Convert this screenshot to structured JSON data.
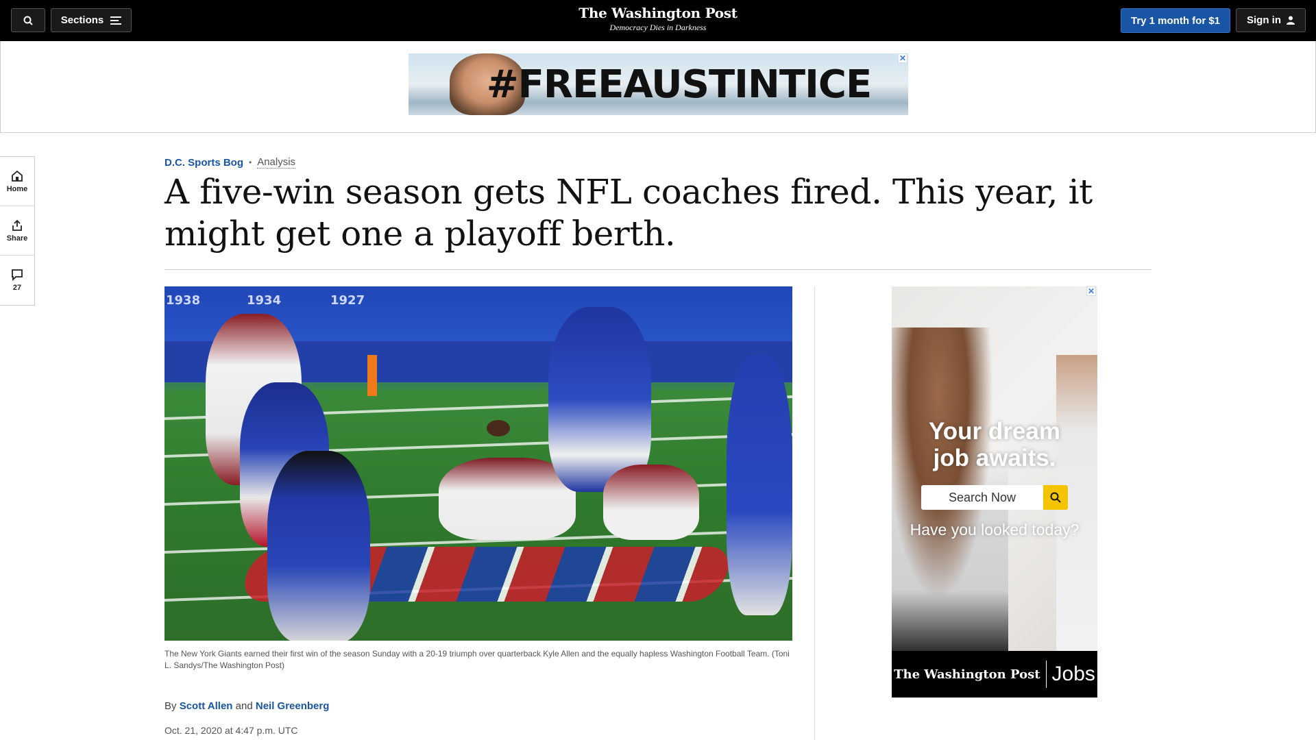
{
  "header": {
    "sections_label": "Sections",
    "logo_title": "The Washington Post",
    "logo_tagline": "Democracy Dies in Darkness",
    "subscribe_label": "Try 1 month for $1",
    "signin_label": "Sign in"
  },
  "top_ad": {
    "text": "#FREEAUSTINTICE",
    "close": "✕"
  },
  "rail": {
    "home_label": "Home",
    "share_label": "Share",
    "comments_count": "27"
  },
  "article": {
    "section": "D.C. Sports Bog",
    "separator": "•",
    "label": "Analysis",
    "headline": "A five-win season gets NFL coaches fired. This year, it might get one a playoff berth.",
    "image_stand_text": [
      "1938",
      "1934",
      "1927"
    ],
    "caption": "The New York Giants earned their first win of the season Sunday with a 20-19 triumph over quarterback Kyle Allen and the equally hapless Washington Football Team. (Toni L. Sandys/The Washington Post)",
    "byline_prefix": "By",
    "author_1": "Scott Allen",
    "byline_and": "and",
    "author_2": "Neil Greenberg",
    "date": "Oct. 21, 2020 at 4:47 p.m. UTC"
  },
  "side_ad": {
    "close": "✕",
    "headline_line1": "Your dream",
    "headline_line2": "job awaits.",
    "search_placeholder": "Search Now",
    "subtext": "Have you looked today?",
    "footer_logo": "The Washington Post",
    "footer_jobs": "Jobs"
  },
  "colors": {
    "brand_blue": "#1955a5",
    "topbar": "#000000",
    "ad_search_button": "#f5c400"
  }
}
